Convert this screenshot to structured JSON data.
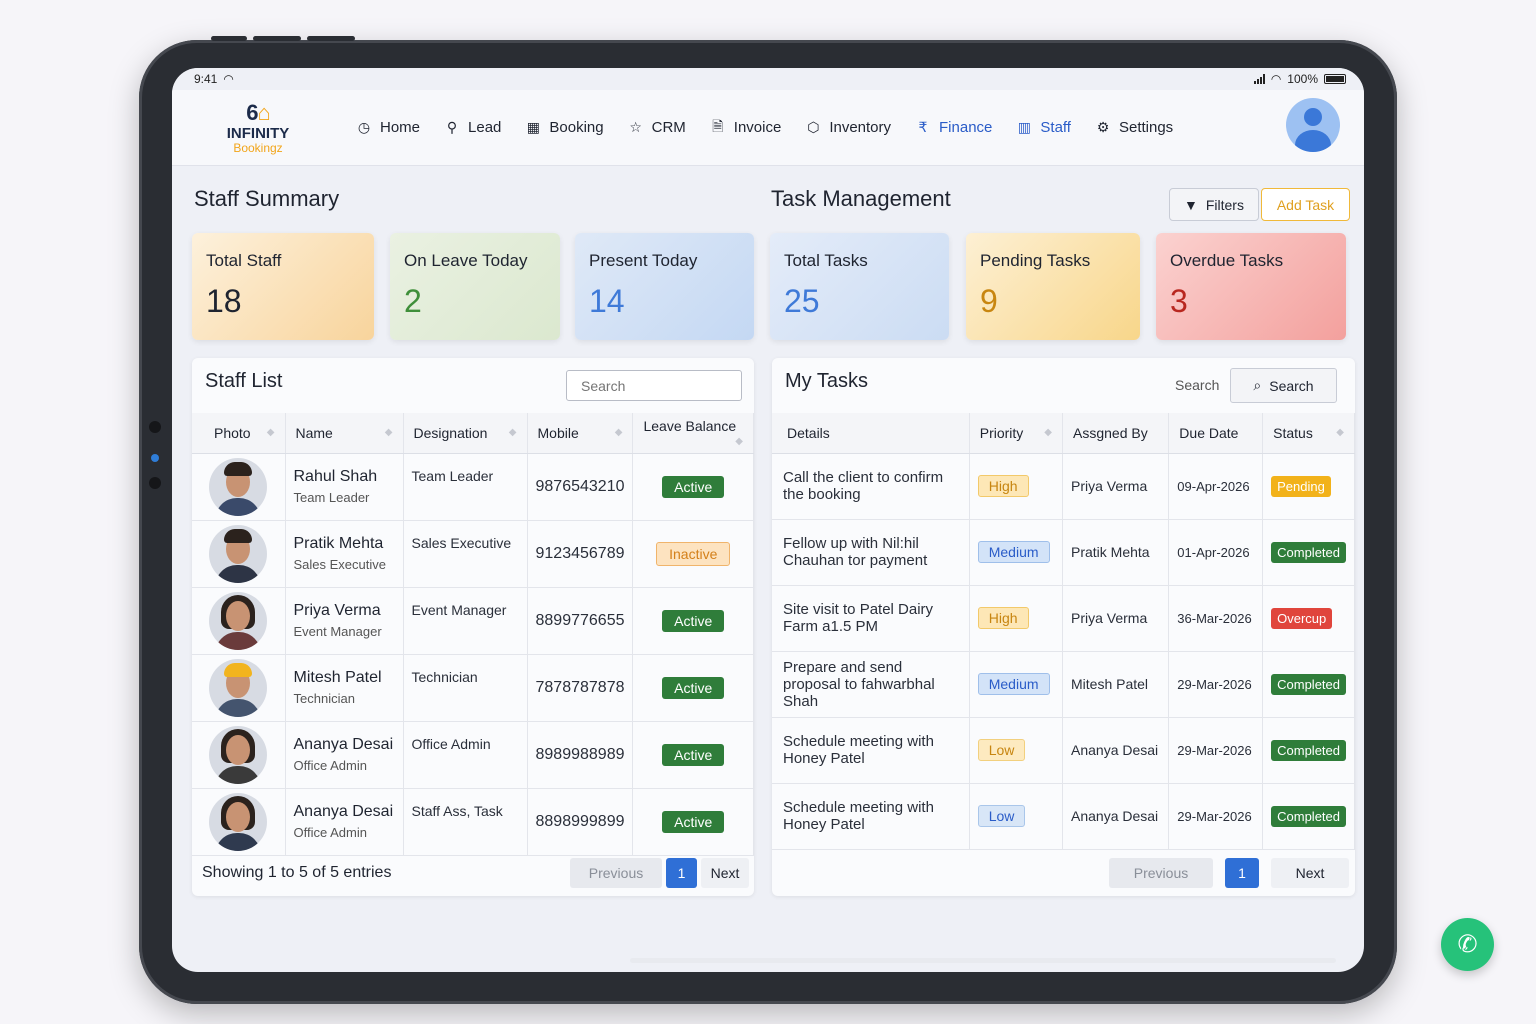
{
  "statusbar": {
    "time": "9:41",
    "battery": "100%"
  },
  "logo": {
    "mark": "6",
    "name": "INFINITY",
    "sub": "Bookingz"
  },
  "nav": [
    {
      "icon": "◷",
      "label": "Home"
    },
    {
      "icon": "⚲",
      "label": "Lead"
    },
    {
      "icon": "▦",
      "label": "Booking"
    },
    {
      "icon": "☆",
      "label": "CRM"
    },
    {
      "icon": "🗎",
      "label": "Invoice"
    },
    {
      "icon": "⬡",
      "label": "Inventory"
    },
    {
      "icon": "₹",
      "label": "Finance"
    },
    {
      "icon": "▥",
      "label": "Staff"
    },
    {
      "icon": "⚙",
      "label": "Settings"
    }
  ],
  "staff_summary": {
    "title": "Staff Summary",
    "cards": [
      {
        "label": "Total Staff",
        "value": "18"
      },
      {
        "label": "On Leave Today",
        "value": "2"
      },
      {
        "label": "Present Today",
        "value": "14"
      }
    ]
  },
  "task_management": {
    "title": "Task Management",
    "filters_label": "Filters",
    "add_task_label": "Add Task",
    "cards": [
      {
        "label": "Total Tasks",
        "value": "25"
      },
      {
        "label": "Pending Tasks",
        "value": "9"
      },
      {
        "label": "Overdue Tasks",
        "value": "3"
      }
    ]
  },
  "staff_list": {
    "title": "Staff List",
    "search_placeholder": "Search",
    "columns": [
      "Photo",
      "Name",
      "Designation",
      "Mobile",
      "Leave Balance"
    ],
    "rows": [
      {
        "name": "Rahul Shah",
        "role": "Team Leader",
        "designation": "Team Leader",
        "mobile": "9876543210",
        "status": "Active"
      },
      {
        "name": "Pratik Mehta",
        "role": "Sales Executive",
        "designation": "Sales Executive",
        "mobile": "9123456789",
        "status": "Inactive"
      },
      {
        "name": "Priya Verma",
        "role": "Event Manager",
        "designation": "Event Manager",
        "mobile": "8899776655",
        "status": "Active"
      },
      {
        "name": "Mitesh Patel",
        "role": "Technician",
        "designation": "Technician",
        "mobile": "7878787878",
        "status": "Active"
      },
      {
        "name": "Ananya Desai",
        "role": "Office Admin",
        "designation": "Office Admin",
        "mobile": "8989988989",
        "status": "Active"
      },
      {
        "name": "Ananya Desai",
        "role": "Office Admin",
        "designation": "Staff Ass,  Task",
        "mobile": "8898999899",
        "status": "Active"
      }
    ],
    "footer": "Showing 1 to 5 of 5 entries",
    "pager": {
      "prev": "Previous",
      "page": "1",
      "next": "Next"
    }
  },
  "my_tasks": {
    "title": "My Tasks",
    "search_label": "Search",
    "search_button": "Search",
    "columns": [
      "Details",
      "Priority",
      "Assgned By",
      "Due Date",
      "Status"
    ],
    "rows": [
      {
        "details": "Call the client to confirm the booking",
        "priority": "High",
        "assigned_by": "Priya Verma",
        "due": "09-Apr-2026",
        "status": "Pending"
      },
      {
        "details": "Fellow up with Nil:hil Chauhan tor payment",
        "priority": "Medium",
        "assigned_by": "Pratik Mehta",
        "due": "01-Apr-2026",
        "status": "Completed"
      },
      {
        "details": "Site visit to Patel Dairy Farm a1.5 PM",
        "priority": "High",
        "assigned_by": "Priya Verma",
        "due": "36-Mar-2026",
        "status": "Overcup"
      },
      {
        "details": "Prepare and send proposal to fahwarbhal Shah",
        "priority": "Medium",
        "assigned_by": "Mitesh Patel",
        "due": "29-Mar-2026",
        "status": "Completed"
      },
      {
        "details": "Schedule meeting with Honey Patel",
        "priority": "Low",
        "assigned_by": "Ananya Desai",
        "due": "29-Mar-2026",
        "status": "Completed"
      },
      {
        "details": "Schedule meeting with Honey Patel",
        "priority": "Low",
        "assigned_by": "Ananya Desai",
        "due": "29-Mar-2026",
        "status": "Completed"
      }
    ],
    "pager": {
      "prev": "Previous",
      "page": "1",
      "next": "Next"
    }
  }
}
